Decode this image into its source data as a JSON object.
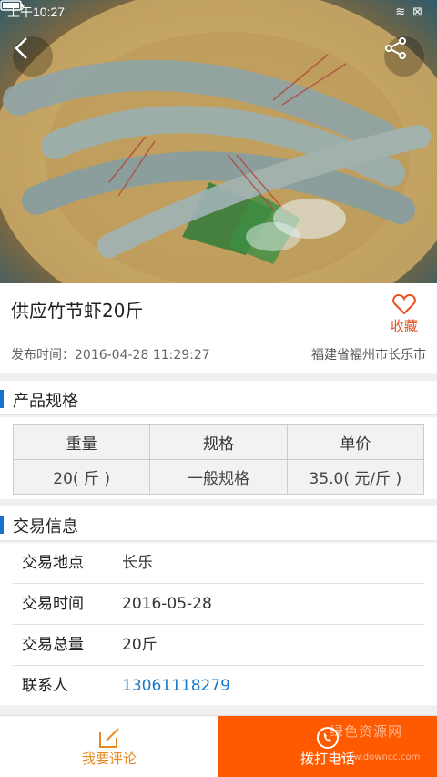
{
  "status_bar": {
    "time": "上午10:27"
  },
  "product": {
    "title": "供应竹节虾20斤",
    "favorite_label": "收藏",
    "publish_time": "发布时间：2016-04-28 11:29:27",
    "location": "福建省福州市长乐市"
  },
  "spec": {
    "header": "产品规格",
    "columns": [
      "重量",
      "规格",
      "单价"
    ],
    "values": [
      "20( 斤 )",
      "一般规格",
      "35.0( 元/斤 )"
    ]
  },
  "trade": {
    "header": "交易信息",
    "rows": [
      {
        "label": "交易地点",
        "value": "长乐"
      },
      {
        "label": "交易时间",
        "value": "2016-05-28"
      },
      {
        "label": "交易总量",
        "value": "20斤"
      },
      {
        "label": "联系人",
        "value": "13061118279"
      }
    ]
  },
  "bottom": {
    "comment_label": "我要评论",
    "call_label": "拨打电话",
    "watermark": "绿色资源网",
    "watermark_url": "www.downcc.com"
  },
  "colors": {
    "accent": "#ff5a00",
    "favorite": "#e8521e",
    "section_bar": "#1a6fd0",
    "phone": "#1a7ac8"
  },
  "icons": [
    "back-icon",
    "share-icon",
    "heart-icon",
    "edit-icon",
    "phone-icon",
    "wifi-icon",
    "battery-icon"
  ]
}
